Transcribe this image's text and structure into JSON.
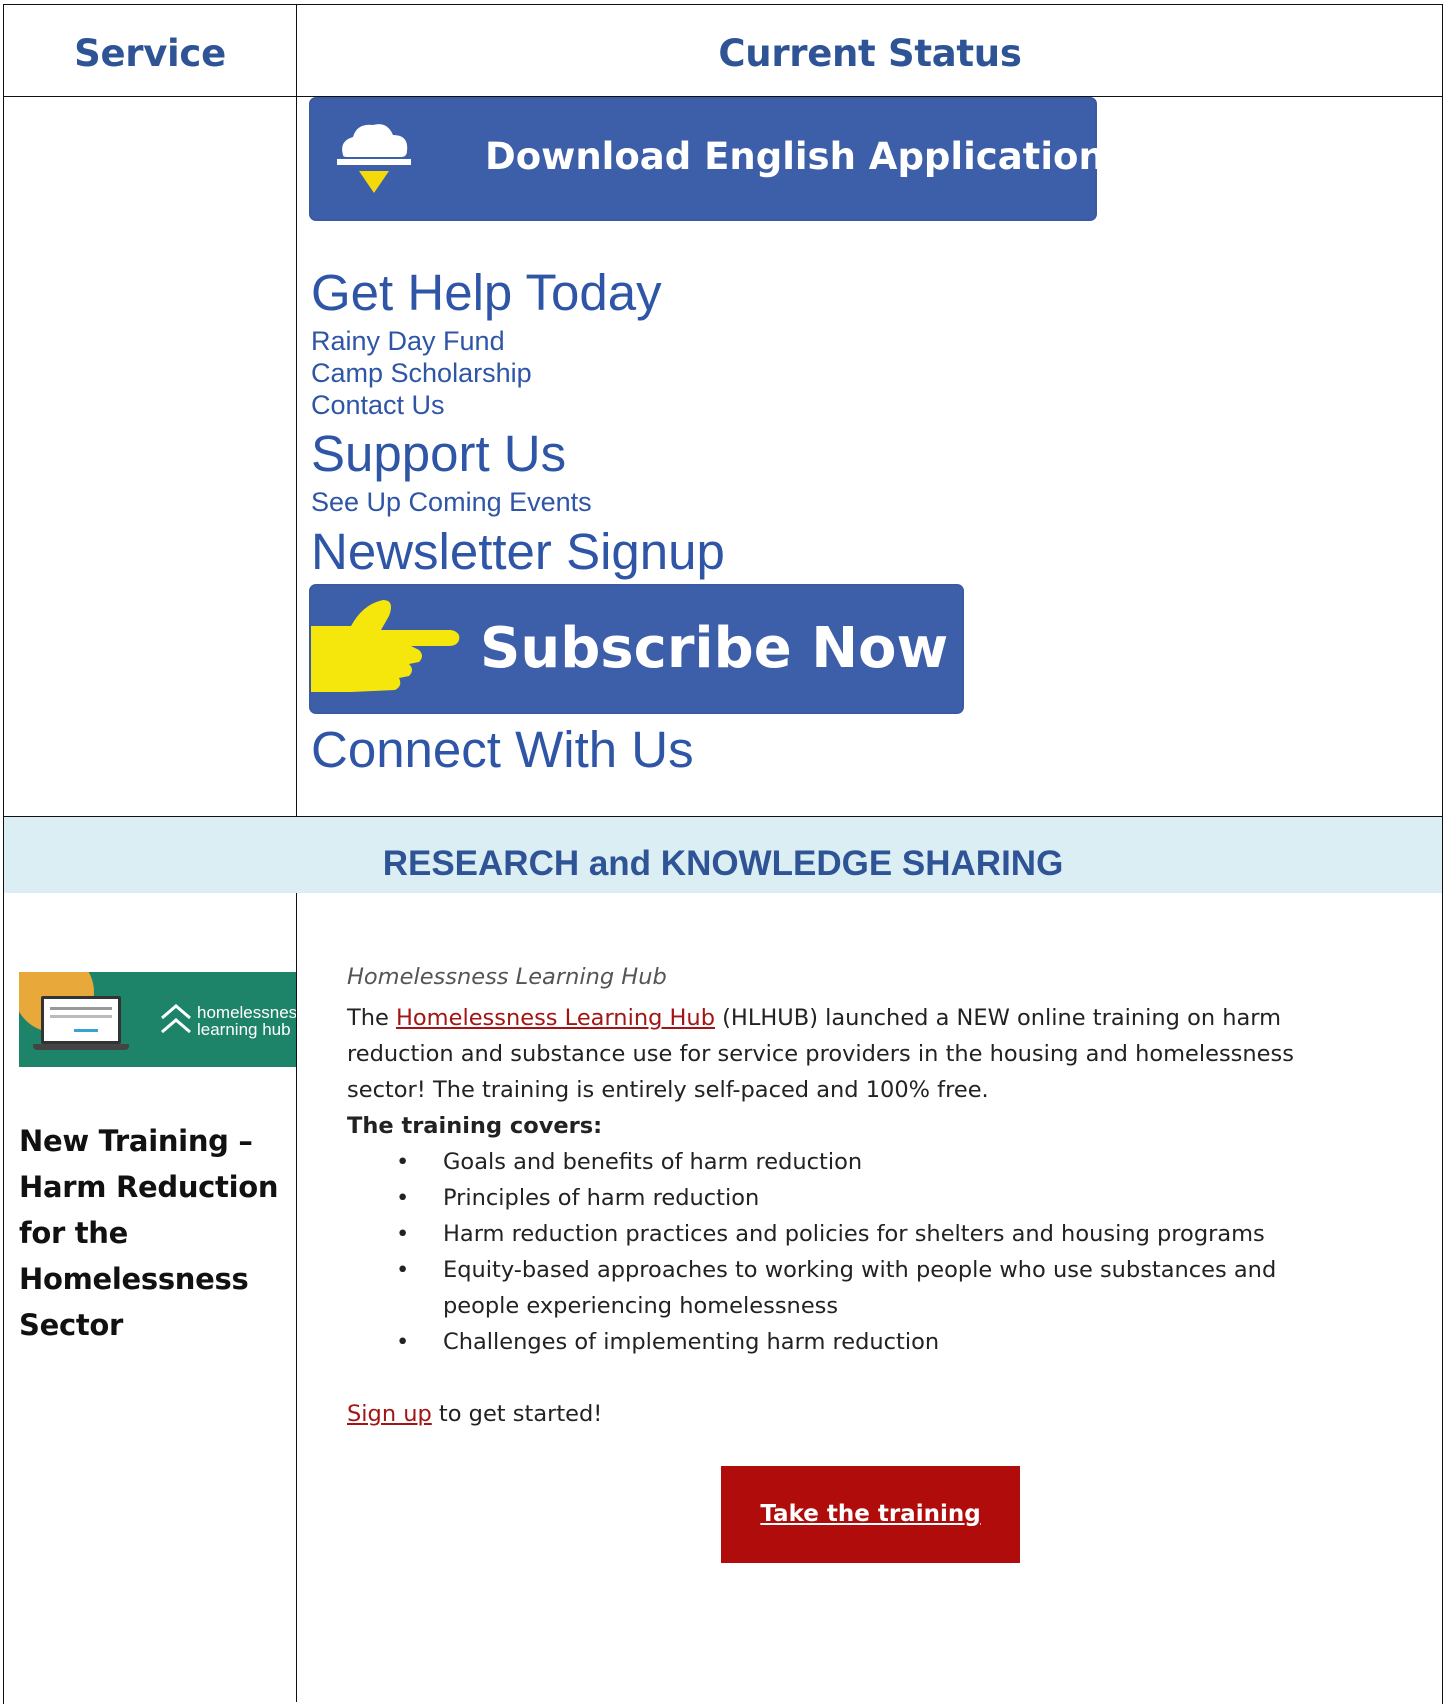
{
  "table": {
    "headers": {
      "service": "Service",
      "status": "Current Status"
    }
  },
  "download_button": {
    "label": "Download English Application",
    "icon": "cloud-download-icon",
    "icon_color": "#f5d90a"
  },
  "nav": {
    "get_help": "Get Help Today",
    "rainy_day": "Rainy Day Fund",
    "camp": "Camp Scholarship",
    "contact": "Contact Us",
    "support": "Support Us",
    "events": "See Up Coming Events",
    "newsletter": "Newsletter Signup",
    "connect": "Connect With Us"
  },
  "subscribe_button": {
    "label": "Subscribe Now",
    "icon": "pointing-hand-icon",
    "icon_color": "#f5e60c"
  },
  "section": {
    "title": "RESEARCH and KNOWLEDGE SHARING"
  },
  "hub_logo": {
    "line1": "homelessness",
    "line2": "learning hub"
  },
  "article": {
    "title": "New Training – Harm Reduction for the Homelessness Sector",
    "label": "Homelessness Learning Hub",
    "intro_before": "The ",
    "intro_link": "Homelessness Learning Hub",
    "intro_after": " (HLHUB) launched a NEW online training on harm reduction and substance use for service providers in the housing and homelessness sector! The training is entirely self-paced and 100% free.",
    "covers_heading": "The training covers:",
    "covers": [
      "Goals and benefits of harm reduction",
      "Principles of harm reduction",
      "Harm reduction practices and policies for shelters and housing programs",
      "Equity-based approaches to working with people who use substances and people experiencing homelessness",
      "Challenges of implementing harm reduction"
    ],
    "signup_link": "Sign up",
    "signup_after": " to get started!",
    "cta_label": "Take the training"
  },
  "colors": {
    "heading_blue": "#2f5496",
    "link_blue": "#2e55a6",
    "band_bg": "#dbeef4",
    "cta_red": "#b00c0c",
    "link_red": "#a31515"
  }
}
